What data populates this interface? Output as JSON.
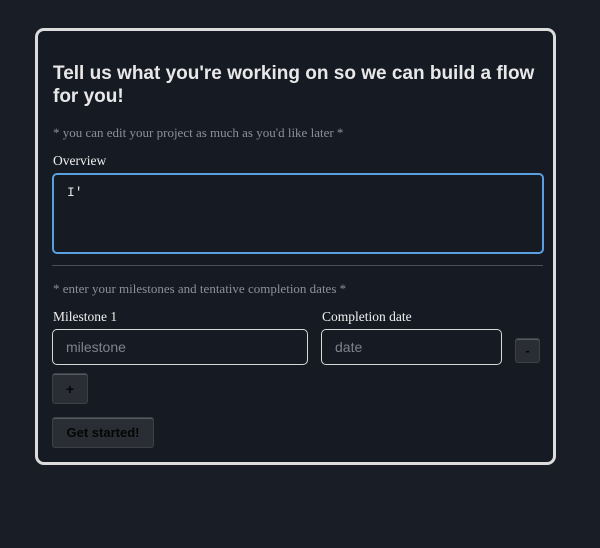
{
  "form": {
    "title": "Tell us what you're working on so we can build a flow for you!",
    "edit_note": "* you can edit your project as much as you'd like later *",
    "overview_label": "Overview",
    "overview_value": "I'",
    "milestones_note": "* enter your milestones and tentative completion dates *",
    "milestones": [
      {
        "label": "Milestone 1",
        "placeholder": "milestone",
        "date_label": "Completion date",
        "date_placeholder": "date",
        "remove_label": "-"
      }
    ],
    "add_label": "+",
    "submit_label": "Get started!"
  },
  "colors": {
    "background": "#191d26",
    "card_border": "#dcdcdc",
    "focus_border": "#5a9fe0",
    "muted_text": "#8d9099"
  }
}
